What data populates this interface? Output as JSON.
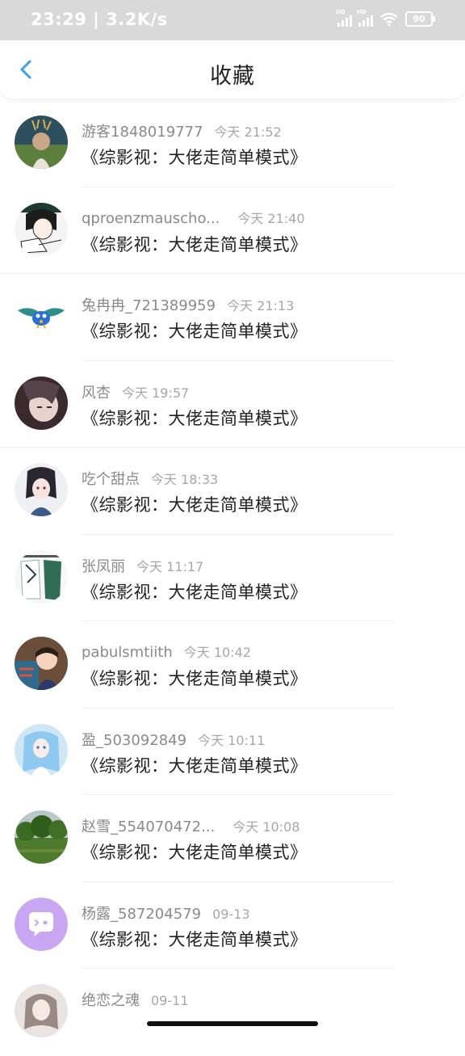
{
  "status_bar": {
    "time": "23:29",
    "speed": "3.2K/s",
    "battery": "90",
    "hd": "HD"
  },
  "header": {
    "title": "收藏"
  },
  "items": [
    {
      "user": "游客1848019777",
      "time": "今天 21:52",
      "title": "《综影视：大佬走简单模式》",
      "avatar": "forest-person"
    },
    {
      "user": "qproenzmauscho...",
      "time": "今天 21:40",
      "title": "《综影视：大佬走简单模式》",
      "avatar": "sketch-girl"
    },
    {
      "user": "兔冉冉_721389959",
      "time": "今天 21:13",
      "title": "《综影视：大佬走简单模式》",
      "avatar": "blue-bird"
    },
    {
      "user": "风杏",
      "time": "今天 19:57",
      "title": "《综影视：大佬走简单模式》",
      "avatar": "anime-portrait"
    },
    {
      "user": "吃个甜点",
      "time": "今天 18:33",
      "title": "《综影视：大佬走简单模式》",
      "avatar": "anime-girl"
    },
    {
      "user": "张凤丽",
      "time": "今天 11:17",
      "title": "《综影视：大佬走简单模式》",
      "avatar": "clothes"
    },
    {
      "user": "pabulsmtiith",
      "time": "今天 10:42",
      "title": "《综影视：大佬走简单模式》",
      "avatar": "child-photo"
    },
    {
      "user": "盈_503092849",
      "time": "今天 10:11",
      "title": "《综影视：大佬走简单模式》",
      "avatar": "blue-anime"
    },
    {
      "user": "赵雪_554070472...",
      "time": "今天 10:08",
      "title": "《综影视：大佬走简单模式》",
      "avatar": "trees"
    },
    {
      "user": "杨露_587204579",
      "time": "09-13",
      "title": "《综影视：大佬走简单模式》",
      "avatar": "chat-bubble-icon"
    },
    {
      "user": "绝恋之魂",
      "time": "09-11",
      "title": "",
      "avatar": "girl-photo"
    }
  ],
  "colors": {
    "accent": "#3aa0e8",
    "status_bar": "#d9d9d9",
    "bubble": "#c9a6f1"
  }
}
